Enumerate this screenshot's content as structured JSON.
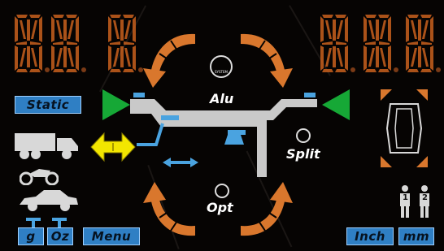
{
  "display": {
    "left_digits": [
      "8",
      "8",
      "8"
    ],
    "right_digits": [
      "8",
      "8",
      "8"
    ]
  },
  "buttons": {
    "static": "Static",
    "unit_g": "g",
    "unit_oz": "Oz",
    "menu": "Menu",
    "inch": "Inch",
    "mm": "mm"
  },
  "modes": {
    "alu": "Alu",
    "split": "Split",
    "opt": "Opt",
    "logo_text": "SYSTEM"
  },
  "operators": [
    "1",
    "2"
  ],
  "colors": {
    "segment": "#c8601e",
    "arrow": "#d9772d",
    "button": "#2f7fc4",
    "green": "#16a836",
    "yellow": "#f2e600",
    "shaft": "#c9c9c9",
    "weight": "#4aa3e0"
  }
}
